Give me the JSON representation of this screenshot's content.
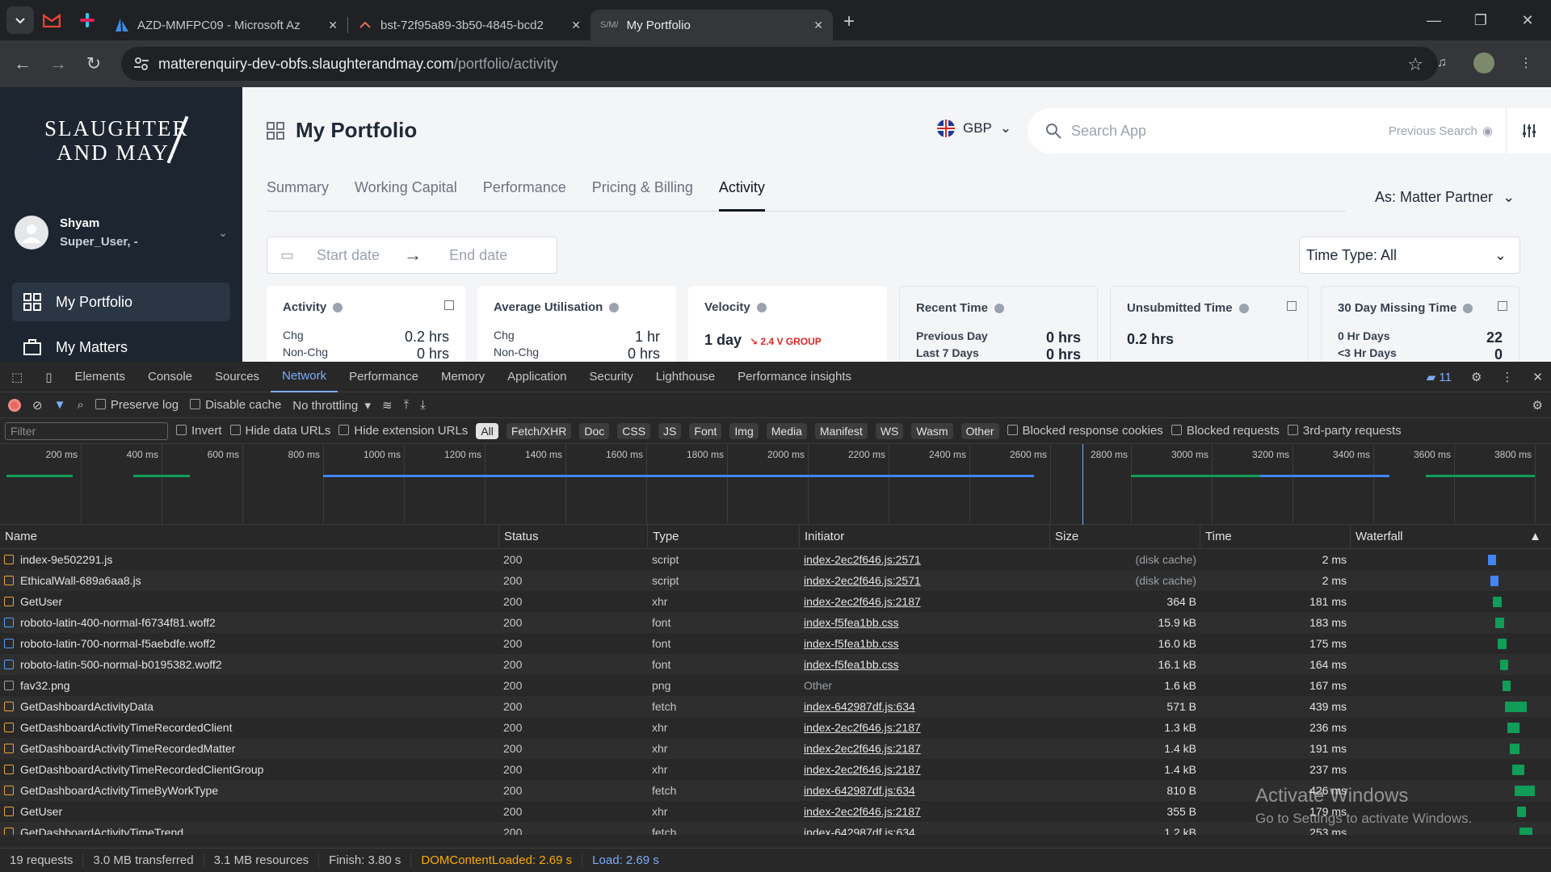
{
  "browser": {
    "tabs": [
      {
        "title": "AZD-MMFPC09 - Microsoft Az"
      },
      {
        "title": "bst-72f95a89-3b50-4845-bcd2"
      },
      {
        "title": "My Portfolio"
      }
    ],
    "url_host": "matterenquiry-dev-obfs.slaughterandmay.com",
    "url_path": "/portfolio/activity"
  },
  "app": {
    "logo_line1": "SLAUGHTER",
    "logo_line2": "AND MAY",
    "user": {
      "name": "Shyam",
      "role": "Super_User, -"
    },
    "nav": [
      {
        "label": "My Portfolio"
      },
      {
        "label": "My Matters"
      }
    ],
    "page_title": "My Portfolio",
    "currency": "GBP",
    "search_placeholder": "Search App",
    "previous_search": "Previous Search",
    "tabs": [
      "Summary",
      "Working Capital",
      "Performance",
      "Pricing & Billing",
      "Activity"
    ],
    "active_tab": "Activity",
    "as_role": "As:  Matter Partner",
    "start_date": "Start date",
    "end_date": "End date",
    "time_type": "Time Type: All",
    "cards": {
      "activity": {
        "title": "Activity",
        "r1_label": "Chg",
        "r1_value": "0.2 hrs",
        "r2_label": "Non-Chg",
        "r2_value": "0 hrs"
      },
      "utilisation": {
        "title": "Average Utilisation",
        "r1_label": "Chg",
        "r1_value": "1 hr",
        "r2_label": "Non-Chg",
        "r2_value": "0 hrs"
      },
      "velocity": {
        "title": "Velocity",
        "value": "1 day",
        "trend": "2.4 V GROUP"
      },
      "recent": {
        "title": "Recent Time",
        "r1_label": "Previous Day",
        "r1_value": "0 hrs",
        "r2_label": "Last 7 Days",
        "r2_value": "0 hrs"
      },
      "unsubmitted": {
        "title": "Unsubmitted Time",
        "value": "0.2 hrs"
      },
      "missing": {
        "title": "30 Day Missing Time",
        "r1_label": "0 Hr Days",
        "r1_value": "22",
        "r2_label": "<3 Hr Days",
        "r2_value": "0"
      }
    }
  },
  "devtools": {
    "tabs": [
      "Elements",
      "Console",
      "Sources",
      "Network",
      "Performance",
      "Memory",
      "Application",
      "Security",
      "Lighthouse",
      "Performance insights"
    ],
    "active_tab": "Network",
    "issues_count": "11",
    "preserve_log": "Preserve log",
    "disable_cache": "Disable cache",
    "throttling": "No throttling",
    "filter_placeholder": "Filter",
    "invert": "Invert",
    "hide_data_urls": "Hide data URLs",
    "hide_ext_urls": "Hide extension URLs",
    "type_filters": [
      "All",
      "Fetch/XHR",
      "Doc",
      "CSS",
      "JS",
      "Font",
      "Img",
      "Media",
      "Manifest",
      "WS",
      "Wasm",
      "Other"
    ],
    "blocked_cookies": "Blocked response cookies",
    "blocked_requests": "Blocked requests",
    "third_party": "3rd-party requests",
    "timeline_ticks": [
      "200 ms",
      "400 ms",
      "600 ms",
      "800 ms",
      "1000 ms",
      "1200 ms",
      "1400 ms",
      "1600 ms",
      "1800 ms",
      "2000 ms",
      "2200 ms",
      "2400 ms",
      "2600 ms",
      "2800 ms",
      "3000 ms",
      "3200 ms",
      "3400 ms",
      "3600 ms",
      "3800 ms"
    ],
    "columns": [
      "Name",
      "Status",
      "Type",
      "Initiator",
      "Size",
      "Time",
      "Waterfall"
    ],
    "rows": [
      {
        "name": "index-9e502291.js",
        "status": "200",
        "type": "script",
        "initiator": "index-2ec2f646.js:2571",
        "size": "(disk cache)",
        "time": "2 ms",
        "icon": "script"
      },
      {
        "name": "EthicalWall-689a6aa8.js",
        "status": "200",
        "type": "script",
        "initiator": "index-2ec2f646.js:2571",
        "size": "(disk cache)",
        "time": "2 ms",
        "icon": "script"
      },
      {
        "name": "GetUser",
        "status": "200",
        "type": "xhr",
        "initiator": "index-2ec2f646.js:2187",
        "size": "364 B",
        "time": "181 ms",
        "icon": "xhr"
      },
      {
        "name": "roboto-latin-400-normal-f6734f81.woff2",
        "status": "200",
        "type": "font",
        "initiator": "index-f5fea1bb.css",
        "size": "15.9 kB",
        "time": "183 ms",
        "icon": "font"
      },
      {
        "name": "roboto-latin-700-normal-f5aebdfe.woff2",
        "status": "200",
        "type": "font",
        "initiator": "index-f5fea1bb.css",
        "size": "16.0 kB",
        "time": "175 ms",
        "icon": "font"
      },
      {
        "name": "roboto-latin-500-normal-b0195382.woff2",
        "status": "200",
        "type": "font",
        "initiator": "index-f5fea1bb.css",
        "size": "16.1 kB",
        "time": "164 ms",
        "icon": "font"
      },
      {
        "name": "fav32.png",
        "status": "200",
        "type": "png",
        "initiator": "Other",
        "size": "1.6 kB",
        "time": "167 ms",
        "icon": "img"
      },
      {
        "name": "GetDashboardActivityData",
        "status": "200",
        "type": "fetch",
        "initiator": "index-642987df.js:634",
        "size": "571 B",
        "time": "439 ms",
        "icon": "xhr"
      },
      {
        "name": "GetDashboardActivityTimeRecordedClient",
        "status": "200",
        "type": "xhr",
        "initiator": "index-2ec2f646.js:2187",
        "size": "1.3 kB",
        "time": "236 ms",
        "icon": "xhr"
      },
      {
        "name": "GetDashboardActivityTimeRecordedMatter",
        "status": "200",
        "type": "xhr",
        "initiator": "index-2ec2f646.js:2187",
        "size": "1.4 kB",
        "time": "191 ms",
        "icon": "xhr"
      },
      {
        "name": "GetDashboardActivityTimeRecordedClientGroup",
        "status": "200",
        "type": "xhr",
        "initiator": "index-2ec2f646.js:2187",
        "size": "1.4 kB",
        "time": "237 ms",
        "icon": "xhr"
      },
      {
        "name": "GetDashboardActivityTimeByWorkType",
        "status": "200",
        "type": "fetch",
        "initiator": "index-642987df.js:634",
        "size": "810 B",
        "time": "426 ms",
        "icon": "xhr"
      },
      {
        "name": "GetUser",
        "status": "200",
        "type": "xhr",
        "initiator": "index-2ec2f646.js:2187",
        "size": "355 B",
        "time": "179 ms",
        "icon": "xhr"
      },
      {
        "name": "GetDashboardActivityTimeTrend",
        "status": "200",
        "type": "fetch",
        "initiator": "index-642987df.js:634",
        "size": "1.2 kB",
        "time": "253 ms",
        "icon": "xhr"
      }
    ],
    "status": {
      "requests": "19 requests",
      "transferred": "3.0 MB transferred",
      "resources": "3.1 MB resources",
      "finish": "Finish: 3.80 s",
      "dcl": "DOMContentLoaded: 2.69 s",
      "load": "Load: 2.69 s"
    }
  },
  "watermark": {
    "line1": "Activate Windows",
    "line2": "Go to Settings to activate Windows."
  }
}
